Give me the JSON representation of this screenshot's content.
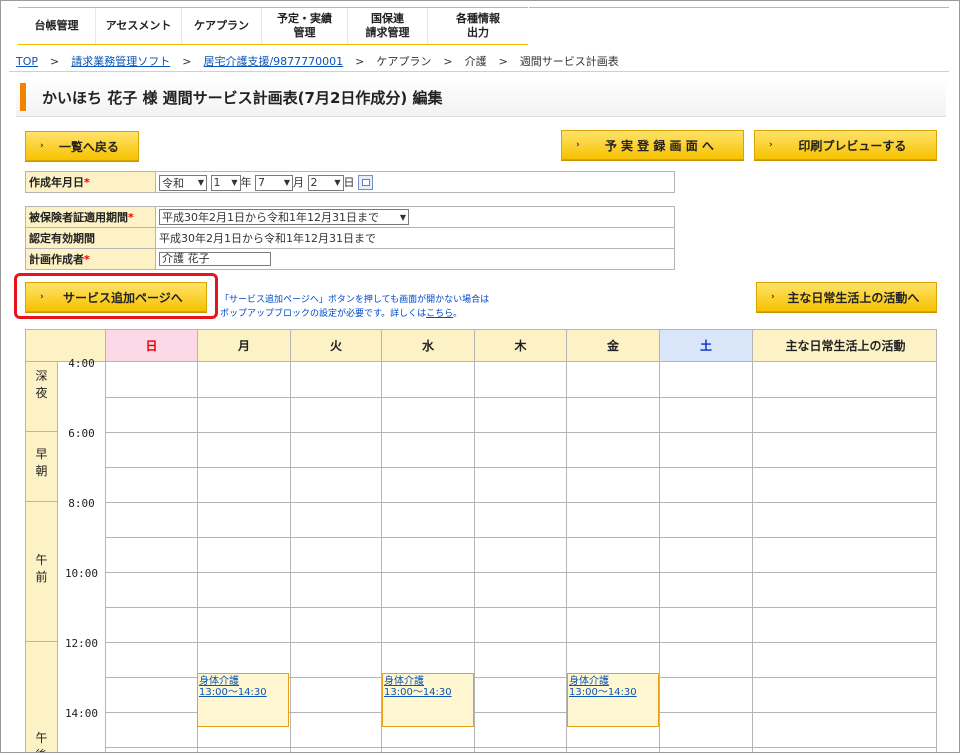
{
  "top_menu": [
    "台帳管理",
    "アセスメント",
    "ケアプラン",
    "予定・実績\n管理",
    "国保連\n請求管理",
    "各種情報\n出力"
  ],
  "breadcrumb": {
    "links": [
      "TOP",
      "請求業務管理ソフト",
      "居宅介護支援/9877770001"
    ],
    "items": [
      "ケアプラン",
      "介護",
      "週間サービス計画表"
    ],
    "separator": ">"
  },
  "page_title": "かいほち 花子 様 週間サービス計画表(7月2日作成分) 編集",
  "buttons": {
    "back": "一覧へ戻る",
    "schedule_register": "予 実 登 録 画 面 へ",
    "print_preview": "印刷プレビューする",
    "add_service": "サービス追加ページへ",
    "daily_activities": "主な日常生活上の活動へ"
  },
  "form": {
    "created_date": {
      "label": "作成年月日",
      "era": "令和",
      "year": "1",
      "year_unit": "年",
      "month": "7",
      "month_unit": "月",
      "day": "2",
      "day_unit": "日"
    },
    "insurance_period": {
      "label": "被保険者証適用期間",
      "value": "平成30年2月1日から令和1年12月31日まで"
    },
    "cert_period": {
      "label": "認定有効期間",
      "value": "平成30年2月1日から令和1年12月31日まで"
    },
    "planner": {
      "label": "計画作成者",
      "value": "介護 花子"
    },
    "required_mark": "*"
  },
  "popup_note": {
    "line1": "「サービス追加ページへ」ボタンを押しても画面が開かない場合は",
    "line2": "ポップアップブロックの設定が必要です。詳しくは",
    "link": "こちら",
    "end": "。"
  },
  "schedule": {
    "days": [
      "日",
      "月",
      "火",
      "水",
      "木",
      "金",
      "土"
    ],
    "activities_header": "主な日常生活上の活動",
    "periods": [
      "深\n夜",
      "早\n朝",
      "午\n前",
      "午\n後"
    ],
    "times": [
      "4:00",
      "6:00",
      "8:00",
      "10:00",
      "12:00",
      "14:00"
    ],
    "services": [
      {
        "day": "月",
        "name": "身体介護",
        "time": "13:00～14:30"
      },
      {
        "day": "水",
        "name": "身体介護",
        "time": "13:00～14:30"
      },
      {
        "day": "金",
        "name": "身体介護",
        "time": "13:00～14:30"
      }
    ]
  },
  "colors": {
    "sunday_header": "#fcd9e6",
    "saturday_header": "#d9e6fa",
    "sunday_text": "#e00000",
    "saturday_text": "#0033cc",
    "label_bg": "#fdf2c6",
    "accent": "#f08300",
    "highlight": "#e8141c"
  }
}
